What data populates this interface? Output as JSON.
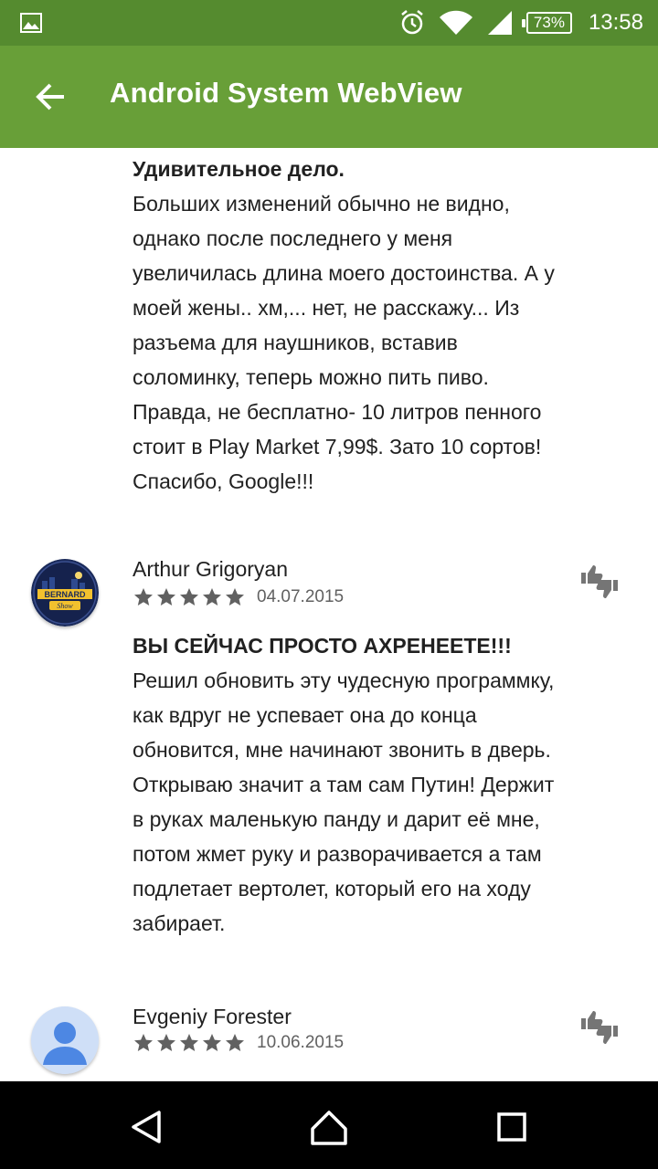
{
  "status_bar": {
    "battery": "73%",
    "time": "13:58",
    "icons": [
      "image-notification-icon",
      "alarm-icon",
      "wifi-icon",
      "signal-icon",
      "battery-icon"
    ]
  },
  "app_bar": {
    "title": "Android System WebView",
    "back_icon": "arrow-back-icon",
    "color": "#689f38"
  },
  "reviews": [
    {
      "title": "Удивительное дело.",
      "lines": [
        "Больших изменений обычно не видно,",
        "однако после последнего у меня",
        "увеличилась длина моего достоинства. А у",
        "моей жены.. хм,... нет, не расскажу... Из",
        "разъема для наушников, вставив",
        "соломинку, теперь можно пить пиво.",
        "Правда, не бесплатно- 10 литров пенного",
        "стоит в Play Market 7,99$. Зато 10 сортов!",
        "Спасибо, Google!!!"
      ]
    },
    {
      "author": "Arthur Grigoryan",
      "stars": 5,
      "date": "04.07.2015",
      "avatar_text": [
        "BERNARD",
        "Show"
      ],
      "title": "ВЫ СЕЙЧАС ПРОСТО АХРЕНЕЕТЕ!!!",
      "lines": [
        "Решил обновить эту чудесную программку,",
        "как вдруг не успевает она до конца",
        "обновится, мне начинают звонить в дверь.",
        "Открываю значит а там сам Путин! Держит",
        "в руках маленькую панду и дарит её мне,",
        "потом жмет руку и разворачивается а там",
        "подлетает вертолет, который его на ходу",
        "забирает."
      ]
    },
    {
      "author": "Evgeniy Forester",
      "stars": 5,
      "date": "10.06.2015"
    }
  ],
  "nav_bar": {
    "back": "nav-back-icon",
    "home": "nav-home-icon",
    "recents": "nav-recents-icon"
  }
}
